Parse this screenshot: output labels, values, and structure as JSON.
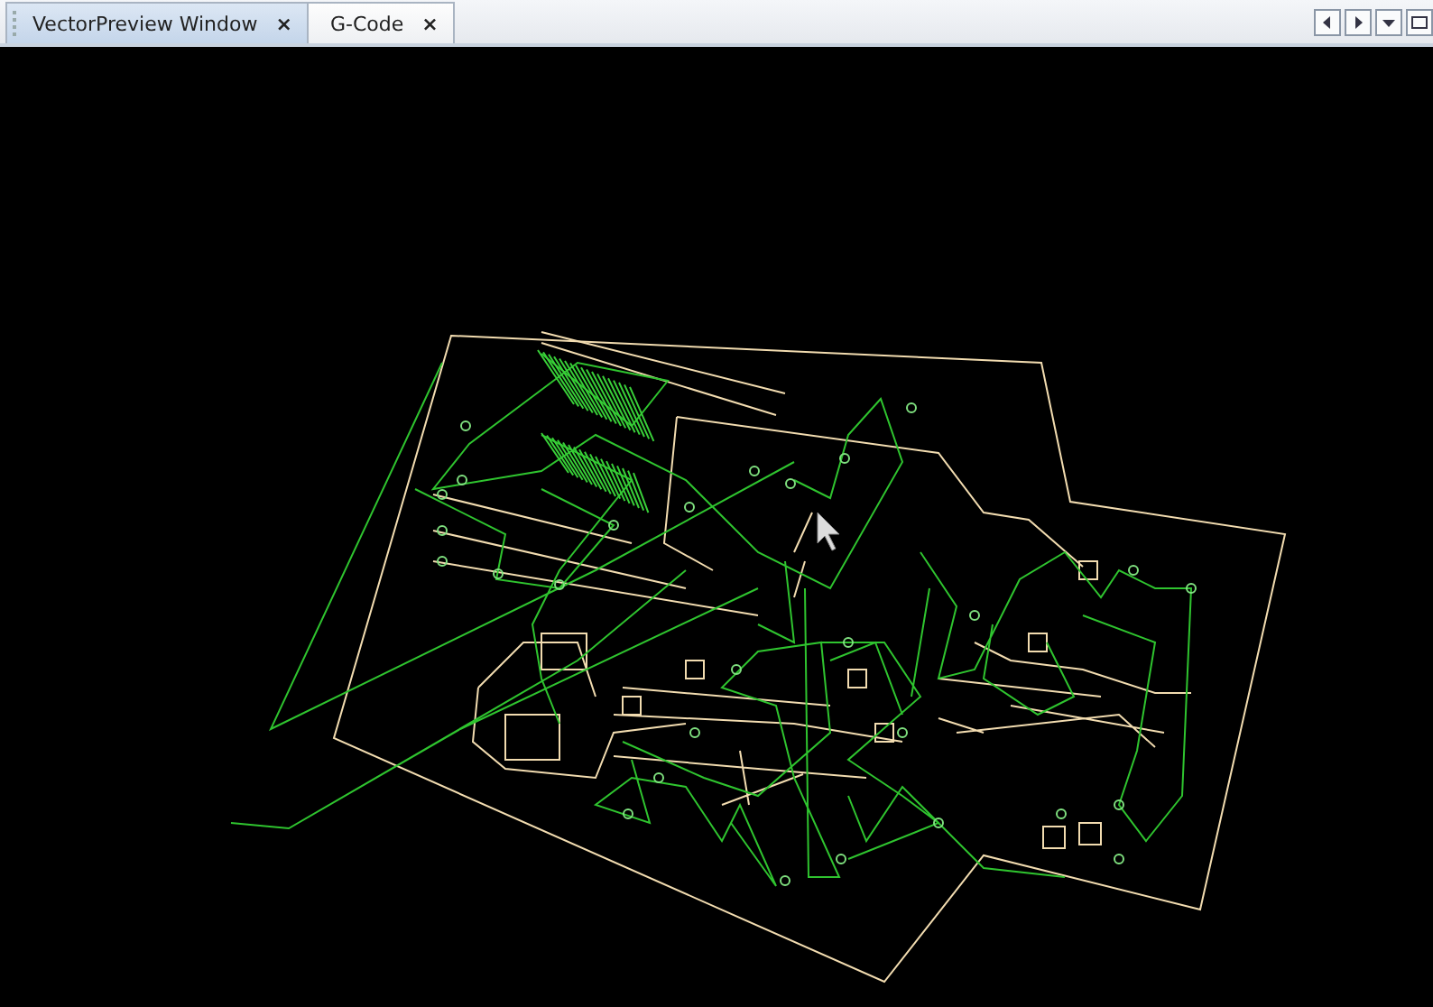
{
  "tabs": [
    {
      "label": "VectorPreview Window",
      "close": "×",
      "selected": true
    },
    {
      "label": "G-Code",
      "close": "×",
      "selected": false
    }
  ]
}
